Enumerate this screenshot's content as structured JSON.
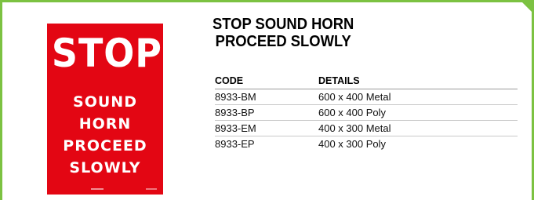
{
  "sign": {
    "top_text": "STOP",
    "lines": [
      "SOUND",
      "HORN",
      "PROCEED",
      "SLOWLY"
    ],
    "background_color": "#e30613",
    "text_color": "#ffffff"
  },
  "product": {
    "title_line_1": "STOP SOUND HORN",
    "title_line_2": "PROCEED SLOWLY"
  },
  "table": {
    "headers": {
      "code": "CODE",
      "details": "DETAILS"
    },
    "rows": [
      {
        "code": "8933-BM",
        "details": "600 x 400 Metal"
      },
      {
        "code": "8933-BP",
        "details": "600 x 400 Poly"
      },
      {
        "code": "8933-EM",
        "details": "400 x 300 Metal"
      },
      {
        "code": "8933-EP",
        "details": "400 x 300 Poly"
      }
    ]
  },
  "colors": {
    "border_accent": "#7cc242"
  }
}
